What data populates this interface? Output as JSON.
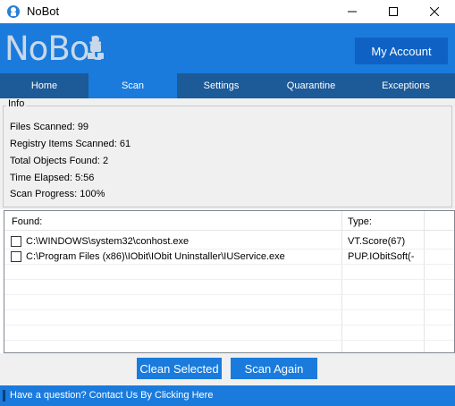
{
  "window": {
    "title": "NoBot",
    "icon": "nobot-app-icon",
    "controls": [
      "minimize-icon",
      "maximize-icon",
      "close-icon"
    ]
  },
  "header": {
    "logo_text": "NoBot",
    "account_button": "My Account"
  },
  "nav": {
    "tabs": [
      {
        "label": "Home",
        "active": false
      },
      {
        "label": "Scan",
        "active": true
      },
      {
        "label": "Settings",
        "active": false
      },
      {
        "label": "Quarantine",
        "active": false
      },
      {
        "label": "Exceptions",
        "active": false
      }
    ]
  },
  "info": {
    "legend": "Info",
    "lines": [
      "Files Scanned: 99",
      "Registry Items Scanned: 61",
      "Total Objects Found: 2",
      "Time Elapsed: 5:56",
      "Scan Progress: 100%"
    ]
  },
  "results": {
    "columns": {
      "found": "Found:",
      "type": "Type:"
    },
    "rows": [
      {
        "checked": false,
        "path": "C:\\WINDOWS\\system32\\conhost.exe",
        "type": "VT.Score(67)"
      },
      {
        "checked": false,
        "path": "C:\\Program Files (x86)\\IObit\\IObit Uninstaller\\IUService.exe",
        "type": "PUP.IObitSoft(-"
      }
    ]
  },
  "actions": {
    "clean": "Clean Selected",
    "scan_again": "Scan Again"
  },
  "footer": {
    "text": "Have a question? Contact Us By Clicking Here"
  },
  "colors": {
    "accent": "#1a7bdc",
    "nav_bg": "#1d5a98",
    "button_dark": "#0f62c4"
  }
}
